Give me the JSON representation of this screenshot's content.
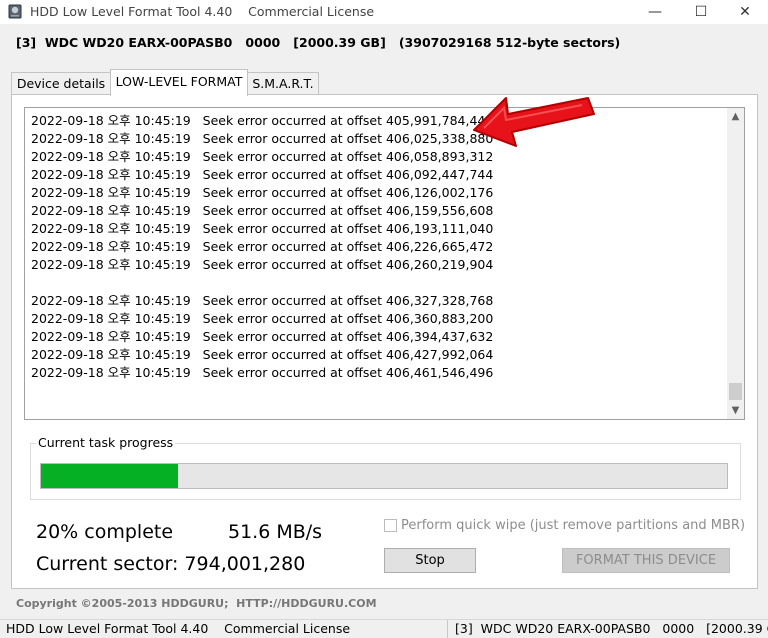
{
  "window": {
    "title": "HDD Low Level Format Tool 4.40    Commercial License",
    "minimize_glyph": "—",
    "maximize_glyph": "☐",
    "close_glyph": "✕"
  },
  "device": {
    "summary": "[3]  WDC WD20 EARX-00PASB0   0000   [2000.39 GB]   (3907029168 512-byte sectors)"
  },
  "tabs": [
    {
      "label": "Device details",
      "active": false
    },
    {
      "label": "LOW-LEVEL FORMAT",
      "active": true
    },
    {
      "label": "S.M.A.R.T.",
      "active": false
    }
  ],
  "log": {
    "lines": [
      {
        "date": "2022-09-18",
        "ampm": "오후",
        "time": "10:45:19",
        "message": "Seek error occurred at offset 405,991,784,448"
      },
      {
        "date": "2022-09-18",
        "ampm": "오후",
        "time": "10:45:19",
        "message": "Seek error occurred at offset 406,025,338,880"
      },
      {
        "date": "2022-09-18",
        "ampm": "오후",
        "time": "10:45:19",
        "message": "Seek error occurred at offset 406,058,893,312"
      },
      {
        "date": "2022-09-18",
        "ampm": "오후",
        "time": "10:45:19",
        "message": "Seek error occurred at offset 406,092,447,744"
      },
      {
        "date": "2022-09-18",
        "ampm": "오후",
        "time": "10:45:19",
        "message": "Seek error occurred at offset 406,126,002,176"
      },
      {
        "date": "2022-09-18",
        "ampm": "오후",
        "time": "10:45:19",
        "message": "Seek error occurred at offset 406,159,556,608"
      },
      {
        "date": "2022-09-18",
        "ampm": "오후",
        "time": "10:45:19",
        "message": "Seek error occurred at offset 406,193,111,040"
      },
      {
        "date": "2022-09-18",
        "ampm": "오후",
        "time": "10:45:19",
        "message": "Seek error occurred at offset 406,226,665,472"
      },
      {
        "date": "2022-09-18",
        "ampm": "오후",
        "time": "10:45:19",
        "message": "Seek error occurred at offset 406,260,219,904"
      },
      null,
      {
        "date": "2022-09-18",
        "ampm": "오후",
        "time": "10:45:19",
        "message": "Seek error occurred at offset 406,327,328,768"
      },
      {
        "date": "2022-09-18",
        "ampm": "오후",
        "time": "10:45:19",
        "message": "Seek error occurred at offset 406,360,883,200"
      },
      {
        "date": "2022-09-18",
        "ampm": "오후",
        "time": "10:45:19",
        "message": "Seek error occurred at offset 406,394,437,632"
      },
      {
        "date": "2022-09-18",
        "ampm": "오후",
        "time": "10:45:19",
        "message": "Seek error occurred at offset 406,427,992,064"
      },
      {
        "date": "2022-09-18",
        "ampm": "오후",
        "time": "10:45:19",
        "message": "Seek error occurred at offset 406,461,546,496"
      }
    ],
    "scroll_up_glyph": "▲",
    "scroll_down_glyph": "▼"
  },
  "progress": {
    "label": "Current task progress",
    "fraction": 0.2,
    "fill_color": "#06b025"
  },
  "stats": {
    "percent_text": "20% complete",
    "speed_text": "51.6 MB/s",
    "sector_text": "Current sector: 794,001,280"
  },
  "options": {
    "quick_wipe_label": "Perform quick wipe (just remove partitions and MBR)",
    "quick_wipe_checked": false
  },
  "buttons": {
    "stop_label": "Stop",
    "format_label": "FORMAT THIS DEVICE"
  },
  "footer": {
    "copyright": "Copyright ©2005-2013 HDDGURU;  HTTP://HDDGURU.COM"
  },
  "statusbar": {
    "left": "HDD Low Level Format Tool 4.40    Commercial License",
    "right": "[3]  WDC WD20 EARX-00PASB0   0000   [2000.39 G"
  },
  "colors": {
    "annotation_arrow": "#e8121b"
  },
  "icons": [
    "hdd-app-icon",
    "minimize-icon",
    "maximize-icon",
    "close-icon",
    "scroll-up-icon",
    "scroll-down-icon",
    "red-arrow-annotation"
  ]
}
